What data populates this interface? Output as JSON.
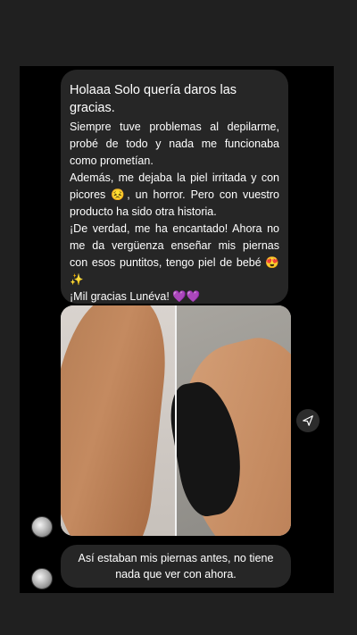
{
  "messages": [
    {
      "first_line": "Holaaa Solo quería daros las gracias.",
      "body": "Siempre tuve problemas al depilarme, probé de todo y nada me funcionaba como prometían.\nAdemás, me dejaba la piel irritada y con picores 😣, un horror. Pero con vuestro producto ha sido otra historia.\n¡De verdad, me ha encantado! Ahora no me da vergüenza enseñar mis piernas con esos puntitos, tengo piel de bebé 😍✨\n¡Mil gracias Lunéva! 💜💜"
    },
    {
      "text": "Así estaban mis piernas antes, no tiene nada que ver con ahora."
    }
  ],
  "icons": {
    "share": "send-icon",
    "avatar": "avatar-icon"
  },
  "colors": {
    "page_bg": "#202020",
    "chat_bg": "#000000",
    "bubble_bg": "#262626",
    "text": "#ffffff"
  }
}
